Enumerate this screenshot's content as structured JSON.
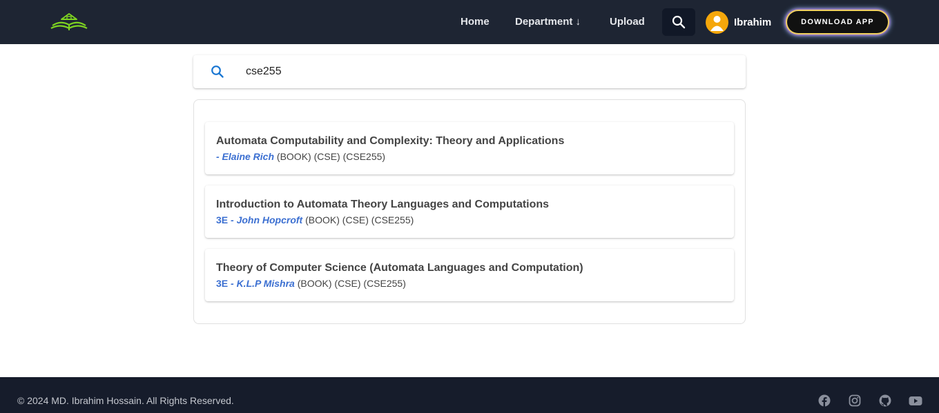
{
  "nav": {
    "home": "Home",
    "department": "Department ↓",
    "upload": "Upload",
    "user_name": "Ibrahim",
    "download_app": "DOWNLOAD APP"
  },
  "search": {
    "value": "cse255",
    "placeholder": ""
  },
  "results": [
    {
      "title": "Automata Computability and Complexity: Theory and Applications",
      "edition": "",
      "author": "- Elaine Rich",
      "meta": " (BOOK) (CSE) (CSE255)"
    },
    {
      "title": "Introduction to Automata Theory Languages and Computations",
      "edition": "3E ",
      "author": "- John Hopcroft",
      "meta": " (BOOK) (CSE) (CSE255)"
    },
    {
      "title": "Theory of Computer Science (Automata Languages and Computation)",
      "edition": "3E ",
      "author": "- K.L.P Mishra",
      "meta": " (BOOK) (CSE) (CSE255)"
    }
  ],
  "footer": {
    "copyright": "© 2024 MD. Ibrahim Hossain. All Rights Reserved.",
    "social_icons": [
      "facebook-icon",
      "instagram-icon",
      "github-icon",
      "youtube-icon"
    ]
  },
  "colors": {
    "navbar": "#1e2533",
    "footer": "#161c2b",
    "accent_blue": "#3b6fd1",
    "logo_green": "#7ed321",
    "avatar": "#f5a70b"
  }
}
